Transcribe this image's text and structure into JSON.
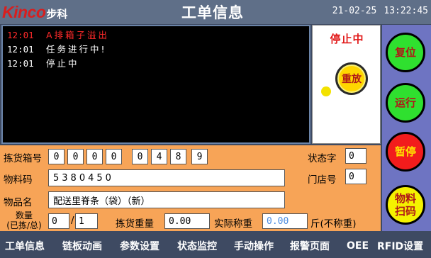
{
  "header": {
    "logo_brand": "Kinco",
    "logo_sub": "步科",
    "title": "工单信息",
    "date": "21-02-25",
    "time": "13:22:45"
  },
  "log": [
    {
      "time": "12:01",
      "message": "A排箱子溢出",
      "level": "alarm"
    },
    {
      "time": "12:01",
      "message": "任务进行中!",
      "level": "info"
    },
    {
      "time": "12:01",
      "message": "停止中",
      "level": "info"
    }
  ],
  "status_panel": {
    "state_text": "停止中",
    "reset_label": "重放"
  },
  "side_buttons": {
    "reset": "复位",
    "run": "运行",
    "pause": "暂停",
    "scan_line1": "物料",
    "scan_line2": "扫码"
  },
  "form": {
    "box_no_label": "拣货箱号",
    "box_no_digits": [
      "0",
      "0",
      "0",
      "0",
      "0",
      "4",
      "8",
      "9"
    ],
    "status_word_label": "状态字",
    "status_word_value": "0",
    "material_code_label": "物料码",
    "material_code_value": "5380450",
    "store_no_label": "门店号",
    "store_no_value": "0",
    "item_name_label": "物品名",
    "item_name_value": "配送里脊条（袋）（新）",
    "qty_label_line1": "数量",
    "qty_label_line2": "(已拣/总)",
    "qty_picked": "0",
    "qty_total": "1",
    "pick_weight_label": "拣货重量",
    "pick_weight_value": "0.00",
    "actual_weight_label": "实际称重",
    "actual_weight_value": "0.00",
    "unit_label": "斤(不称重)"
  },
  "nav": [
    "工单信息",
    "链板动画",
    "参数设置",
    "状态监控",
    "手动操作",
    "报警页面",
    "OEE",
    "RFID设置"
  ],
  "colors": {
    "background": "#3e4a62",
    "form": "#f7a457",
    "alarm_text": "#ff2a2a",
    "side_panel": "#6e74c2"
  }
}
